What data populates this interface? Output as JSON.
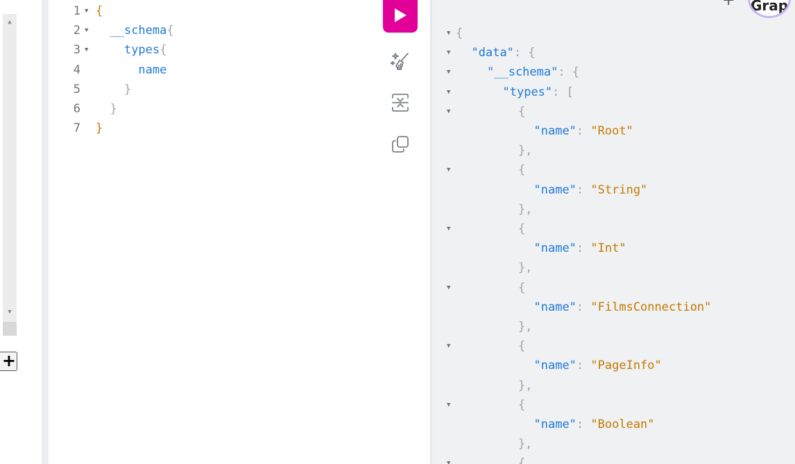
{
  "editor": {
    "lines": [
      {
        "num": "1",
        "fold": true,
        "indent": "",
        "tokens": [
          {
            "t": "{",
            "c": "gold"
          }
        ]
      },
      {
        "num": "2",
        "fold": true,
        "indent": "  ",
        "tokens": [
          {
            "t": "__schema",
            "c": "field"
          },
          {
            "t": "{",
            "c": "grey"
          }
        ]
      },
      {
        "num": "3",
        "fold": true,
        "indent": "    ",
        "tokens": [
          {
            "t": "types",
            "c": "field"
          },
          {
            "t": "{",
            "c": "grey"
          }
        ]
      },
      {
        "num": "4",
        "fold": false,
        "indent": "      ",
        "tokens": [
          {
            "t": "name",
            "c": "field"
          }
        ]
      },
      {
        "num": "5",
        "fold": false,
        "indent": "    ",
        "tokens": [
          {
            "t": "}",
            "c": "grey"
          }
        ]
      },
      {
        "num": "6",
        "fold": false,
        "indent": "  ",
        "tokens": [
          {
            "t": "}",
            "c": "grey"
          }
        ]
      },
      {
        "num": "7",
        "fold": false,
        "indent": "",
        "tokens": [
          {
            "t": "}",
            "c": "gold"
          }
        ]
      }
    ]
  },
  "toolbar": {
    "run_icon": "play-icon",
    "prettify_icon": "prettify-icon",
    "merge_icon": "merge-fragments-icon",
    "copy_icon": "copy-icon"
  },
  "sidebar": {
    "add_label": "+"
  },
  "header": {
    "plus_label": "+",
    "avatar_text": "Grap"
  },
  "result": {
    "lines": [
      {
        "fold": true,
        "indent": 0,
        "tokens": [
          {
            "t": "{",
            "c": "punct"
          }
        ]
      },
      {
        "fold": true,
        "indent": 1,
        "tokens": [
          {
            "t": "\"data\"",
            "c": "key"
          },
          {
            "t": ": {",
            "c": "punct"
          }
        ]
      },
      {
        "fold": true,
        "indent": 2,
        "tokens": [
          {
            "t": "\"__schema\"",
            "c": "key"
          },
          {
            "t": ": {",
            "c": "punct"
          }
        ]
      },
      {
        "fold": true,
        "indent": 3,
        "tokens": [
          {
            "t": "\"types\"",
            "c": "key"
          },
          {
            "t": ": [",
            "c": "punct"
          }
        ]
      },
      {
        "fold": true,
        "indent": 4,
        "tokens": [
          {
            "t": "{",
            "c": "punct"
          }
        ]
      },
      {
        "fold": false,
        "indent": 5,
        "tokens": [
          {
            "t": "\"name\"",
            "c": "key"
          },
          {
            "t": ": ",
            "c": "punct"
          },
          {
            "t": "\"Root\"",
            "c": "str"
          }
        ]
      },
      {
        "fold": false,
        "indent": 4,
        "tokens": [
          {
            "t": "},",
            "c": "punct"
          }
        ]
      },
      {
        "fold": true,
        "indent": 4,
        "tokens": [
          {
            "t": "{",
            "c": "punct"
          }
        ]
      },
      {
        "fold": false,
        "indent": 5,
        "tokens": [
          {
            "t": "\"name\"",
            "c": "key"
          },
          {
            "t": ": ",
            "c": "punct"
          },
          {
            "t": "\"String\"",
            "c": "str"
          }
        ]
      },
      {
        "fold": false,
        "indent": 4,
        "tokens": [
          {
            "t": "},",
            "c": "punct"
          }
        ]
      },
      {
        "fold": true,
        "indent": 4,
        "tokens": [
          {
            "t": "{",
            "c": "punct"
          }
        ]
      },
      {
        "fold": false,
        "indent": 5,
        "tokens": [
          {
            "t": "\"name\"",
            "c": "key"
          },
          {
            "t": ": ",
            "c": "punct"
          },
          {
            "t": "\"Int\"",
            "c": "str"
          }
        ]
      },
      {
        "fold": false,
        "indent": 4,
        "tokens": [
          {
            "t": "},",
            "c": "punct"
          }
        ]
      },
      {
        "fold": true,
        "indent": 4,
        "tokens": [
          {
            "t": "{",
            "c": "punct"
          }
        ]
      },
      {
        "fold": false,
        "indent": 5,
        "tokens": [
          {
            "t": "\"name\"",
            "c": "key"
          },
          {
            "t": ": ",
            "c": "punct"
          },
          {
            "t": "\"FilmsConnection\"",
            "c": "str"
          }
        ]
      },
      {
        "fold": false,
        "indent": 4,
        "tokens": [
          {
            "t": "},",
            "c": "punct"
          }
        ]
      },
      {
        "fold": true,
        "indent": 4,
        "tokens": [
          {
            "t": "{",
            "c": "punct"
          }
        ]
      },
      {
        "fold": false,
        "indent": 5,
        "tokens": [
          {
            "t": "\"name\"",
            "c": "key"
          },
          {
            "t": ": ",
            "c": "punct"
          },
          {
            "t": "\"PageInfo\"",
            "c": "str"
          }
        ]
      },
      {
        "fold": false,
        "indent": 4,
        "tokens": [
          {
            "t": "},",
            "c": "punct"
          }
        ]
      },
      {
        "fold": true,
        "indent": 4,
        "tokens": [
          {
            "t": "{",
            "c": "punct"
          }
        ]
      },
      {
        "fold": false,
        "indent": 5,
        "tokens": [
          {
            "t": "\"name\"",
            "c": "key"
          },
          {
            "t": ": ",
            "c": "punct"
          },
          {
            "t": "\"Boolean\"",
            "c": "str"
          }
        ]
      },
      {
        "fold": false,
        "indent": 4,
        "tokens": [
          {
            "t": "},",
            "c": "punct"
          }
        ]
      },
      {
        "fold": true,
        "indent": 4,
        "tokens": [
          {
            "t": "{",
            "c": "punct"
          }
        ]
      }
    ]
  },
  "colors": {
    "accent": "#e10098",
    "key": "#1f7ad6",
    "string": "#c27a00",
    "punct": "#9ca3af"
  }
}
